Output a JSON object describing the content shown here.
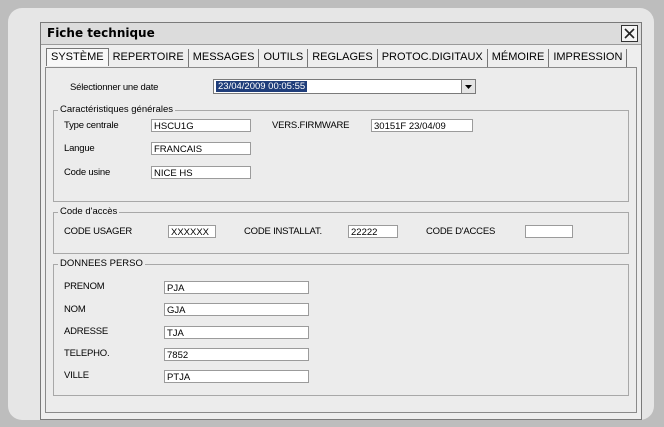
{
  "window": {
    "title": "Fiche technique"
  },
  "tabs": [
    {
      "label": "SYSTÈME",
      "active": true
    },
    {
      "label": "REPERTOIRE"
    },
    {
      "label": "MESSAGES"
    },
    {
      "label": "OUTILS"
    },
    {
      "label": "REGLAGES"
    },
    {
      "label": "PROTOC.DIGITAUX"
    },
    {
      "label": "MÉMOIRE"
    },
    {
      "label": "IMPRESSION"
    }
  ],
  "date_selector": {
    "label": "Sélectionner une date",
    "value": "23/04/2009 00:05:55"
  },
  "general": {
    "legend": "Caractéristiques générales",
    "type_label": "Type centrale",
    "type_value": "HSCU1G",
    "firmware_label": "VERS.FIRMWARE",
    "firmware_value": "30151F   23/04/09",
    "langue_label": "Langue",
    "langue_value": "FRANCAIS",
    "code_usine_label": "Code usine",
    "code_usine_value": "NICE HS"
  },
  "access": {
    "legend": "Code d'accès",
    "usager_label": "CODE USAGER",
    "usager_value": "XXXXXX",
    "installat_label": "CODE INSTALLAT.",
    "installat_value": "22222",
    "acces_label": "CODE D'ACCES",
    "acces_value": ""
  },
  "perso": {
    "legend": "DONNEES PERSO",
    "fields": [
      {
        "label": "PRENOM",
        "value": "PJA"
      },
      {
        "label": "NOM",
        "value": "GJA"
      },
      {
        "label": "ADRESSE",
        "value": "TJA"
      },
      {
        "label": "TELEPHO.",
        "value": "7852"
      },
      {
        "label": "VILLE",
        "value": "PTJA"
      }
    ]
  }
}
